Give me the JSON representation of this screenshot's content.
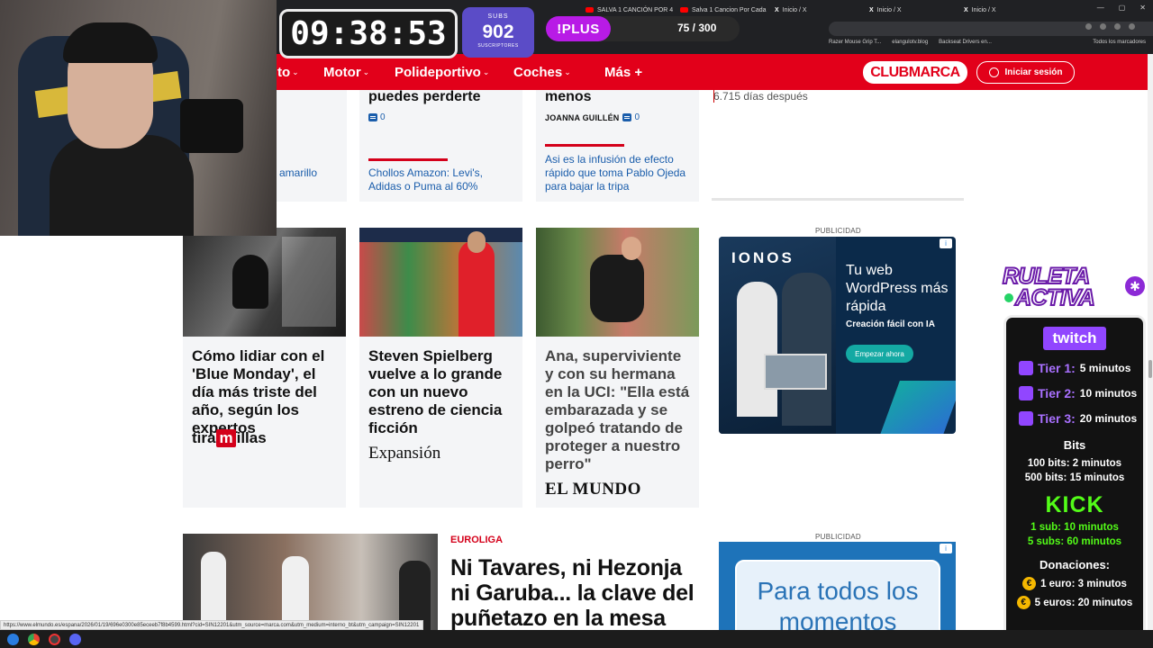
{
  "browser": {
    "tabs": [
      {
        "label": "SALVA 1 CANCIÓN POR 4",
        "type": "youtube"
      },
      {
        "label": "Salva 1 Cancion Por Cada",
        "type": "youtube"
      },
      {
        "label": "Inicio / X",
        "type": "x"
      },
      {
        "label": "Inicio / X",
        "type": "x"
      },
      {
        "label": "Inicio / X",
        "type": "x"
      }
    ],
    "bookmarks": [
      "Razer Mouse Grip T...",
      "elangulotv.blog",
      "Backseat Drivers en..."
    ],
    "bookmarks_right": "Todos los marcadores",
    "status_url": "https://www.elmundo.es/espana/2026/01/19/696e0300e85eceeb7f8b4599.html?cid=SIN12201&utm_source=marca.com&utm_medium=interno_bt&utm_campaign=SIN12201"
  },
  "nav": {
    "items": [
      "to",
      "Motor",
      "Polideportivo",
      "Coches",
      "Más +"
    ],
    "clubmarca": "CLUBMARCA",
    "login": "Iniciar sesión"
  },
  "top_cards": [
    {
      "title": "puedes perderte",
      "comments": "0",
      "related": "Chollos Amazon: Levi's, Adidas o Puma al 60%"
    },
    {
      "title": "menos",
      "author": "JOANNA GUILLÉN",
      "comments": "0",
      "related": "Asi es la infusión de efecto rápido que toma Pablo Ojeda para bajar la tripa"
    }
  ],
  "left_fragment": "amarillo",
  "right_top_text": "6.715 días después",
  "cards": [
    {
      "title": "Cómo lidiar con el 'Blue Monday', el día más triste del año, según los expertos",
      "source": "tiramillas"
    },
    {
      "title": "Steven Spielberg vuelve a lo grande con un nuevo estreno de ciencia ficción",
      "source": "Expansión"
    },
    {
      "title": "Ana, superviviente y con su hermana en la UCI: \"Ella está embarazada y se golpeó tratando de proteger a nuestro perro\"",
      "source": "EL MUNDO"
    }
  ],
  "source_parts": {
    "tira": "tira",
    "m": "m",
    "illas": "illas"
  },
  "feature": {
    "kicker": "EUROLIGA",
    "title": "Ni Tavares, ni Hezonja ni Garuba... la clave del puñetazo en la mesa"
  },
  "ads": {
    "label": "PUBLICIDAD",
    "ionos": {
      "logo": "IONOS",
      "headline": "Tu web WordPress más rápida",
      "sub": "Creación fácil con IA",
      "cta": "Empezar ahora"
    },
    "second": "Para todos los momentos"
  },
  "overlay": {
    "timer": "09:38:53",
    "subs_label": "SUBS",
    "subs_count": "902",
    "subs_sub": "SUSCRIPTORES",
    "plus_label": "!PLUS",
    "plus_count": "75 / 300",
    "ruleta_1": "RULETA",
    "ruleta_2": "ACTIVA",
    "twitch": "twitch",
    "tiers": [
      {
        "name": "Tier 1:",
        "value": "5 minutos"
      },
      {
        "name": "Tier 2:",
        "value": "10 minutos"
      },
      {
        "name": "Tier 3:",
        "value": "20 minutos"
      }
    ],
    "bits_label": "Bits",
    "bits": [
      "100 bits: 2 minutos",
      "500 bits: 15 minutos"
    ],
    "kick": "KICK",
    "kick_lines": [
      "1 sub: 10 minutos",
      "5 subs: 60 minutos"
    ],
    "donations_label": "Donaciones:",
    "donations": [
      "1 euro: 3 minutos",
      "5 euros: 20 minutos"
    ]
  },
  "colors": {
    "marca_red": "#e2001a",
    "twitch_purple": "#9146ff",
    "kick_green": "#53fc18"
  }
}
